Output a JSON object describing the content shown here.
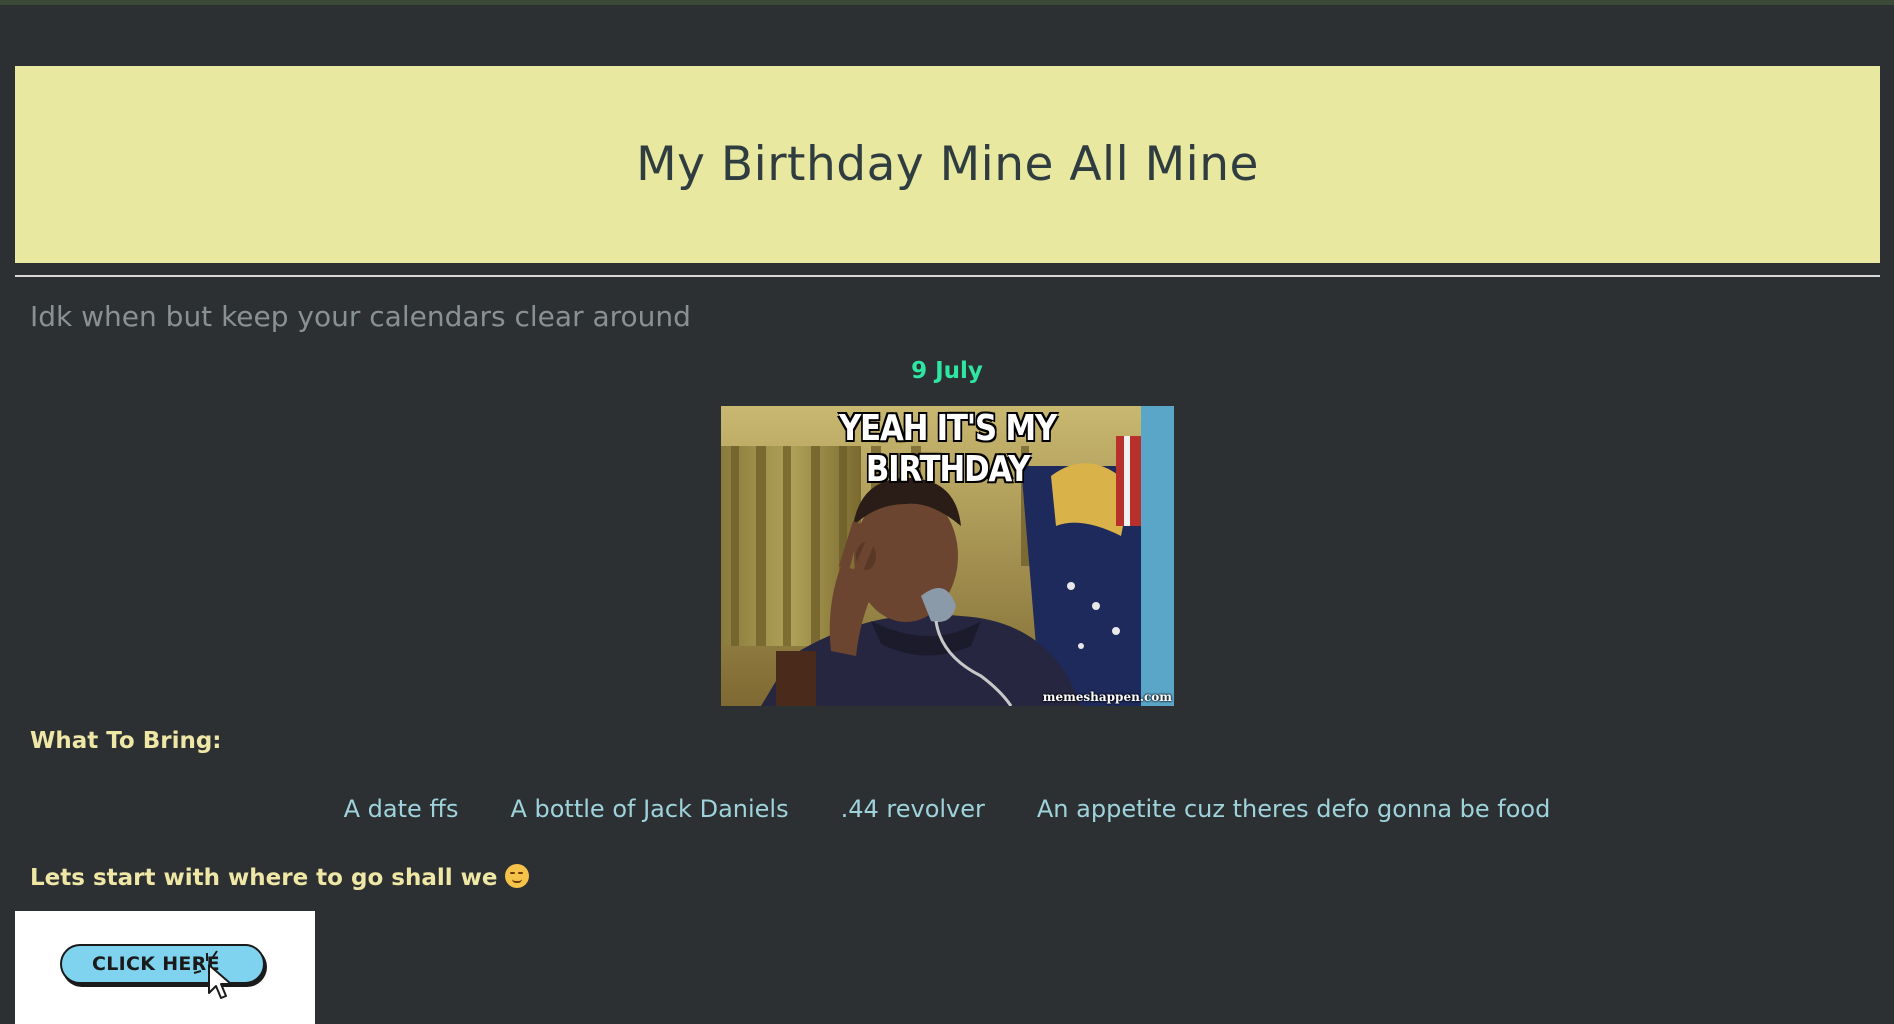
{
  "page": {
    "title": "My Birthday Mine All Mine",
    "subtitle": "Idk when but keep your calendars clear around",
    "date": "9 July"
  },
  "meme": {
    "caption": "YEAH IT'S MY BIRTHDAY",
    "credit": "memeshappen.com"
  },
  "bring": {
    "heading": "What To Bring:",
    "items": [
      "A date ffs",
      "A bottle of Jack Daniels",
      ".44 revolver",
      "An appetite cuz theres defo gonna be food"
    ]
  },
  "where": {
    "heading": "Lets start with where to go shall we",
    "emoji": "smirking-face-emoji",
    "button_label": "CLICK HERE"
  },
  "colors": {
    "background": "#2c3033",
    "banner": "#e8e8a0",
    "date": "#2ee6a2",
    "heading": "#efe7a6",
    "list": "#9fd3dc",
    "button": "#7fd3ee"
  }
}
